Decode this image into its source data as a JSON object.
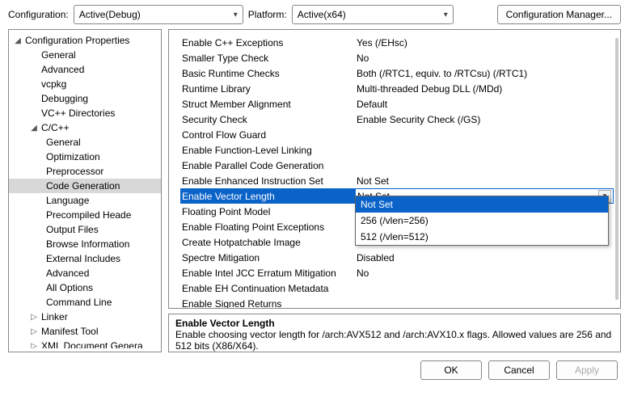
{
  "topbar": {
    "config_label": "Configuration:",
    "config_value": "Active(Debug)",
    "platform_label": "Platform:",
    "platform_value": "Active(x64)",
    "manager_button": "Configuration Manager..."
  },
  "tree": {
    "root": "Configuration Properties",
    "items_l1": [
      "General",
      "Advanced",
      "vcpkg",
      "Debugging",
      "VC++ Directories"
    ],
    "cpp": "C/C++",
    "cpp_items": [
      "General",
      "Optimization",
      "Preprocessor",
      "Code Generation",
      "Language",
      "Precompiled Heade",
      "Output Files",
      "Browse Information",
      "External Includes",
      "Advanced",
      "All Options",
      "Command Line"
    ],
    "tail": [
      "Linker",
      "Manifest Tool",
      "XML Document Genera"
    ]
  },
  "grid": {
    "rows": [
      {
        "name": "Enable C++ Exceptions",
        "value": "Yes (/EHsc)"
      },
      {
        "name": "Smaller Type Check",
        "value": "No"
      },
      {
        "name": "Basic Runtime Checks",
        "value": "Both (/RTC1, equiv. to /RTCsu) (/RTC1)"
      },
      {
        "name": "Runtime Library",
        "value": "Multi-threaded Debug DLL (/MDd)"
      },
      {
        "name": "Struct Member Alignment",
        "value": "Default"
      },
      {
        "name": "Security Check",
        "value": "Enable Security Check (/GS)"
      },
      {
        "name": "Control Flow Guard",
        "value": ""
      },
      {
        "name": "Enable Function-Level Linking",
        "value": ""
      },
      {
        "name": "Enable Parallel Code Generation",
        "value": ""
      },
      {
        "name": "Enable Enhanced Instruction Set",
        "value": "Not Set"
      },
      {
        "name": "Enable Vector Length",
        "value": "Not Set",
        "selected": true
      },
      {
        "name": "Floating Point Model",
        "value": ""
      },
      {
        "name": "Enable Floating Point Exceptions",
        "value": ""
      },
      {
        "name": "Create Hotpatchable Image",
        "value": ""
      },
      {
        "name": "Spectre Mitigation",
        "value": "Disabled"
      },
      {
        "name": "Enable Intel JCC Erratum Mitigation",
        "value": "No"
      },
      {
        "name": "Enable EH Continuation Metadata",
        "value": ""
      },
      {
        "name": "Enable Signed Returns",
        "value": ""
      }
    ],
    "dropdown": [
      "Not Set",
      "256 (/vlen=256)",
      "512 (/vlen=512)"
    ]
  },
  "description": {
    "title": "Enable Vector Length",
    "body": "Enable choosing vector length for /arch:AVX512 and /arch:AVX10.x flags. Allowed values are 256 and 512 bits (X86/X64)."
  },
  "footer": {
    "ok": "OK",
    "cancel": "Cancel",
    "apply": "Apply"
  }
}
